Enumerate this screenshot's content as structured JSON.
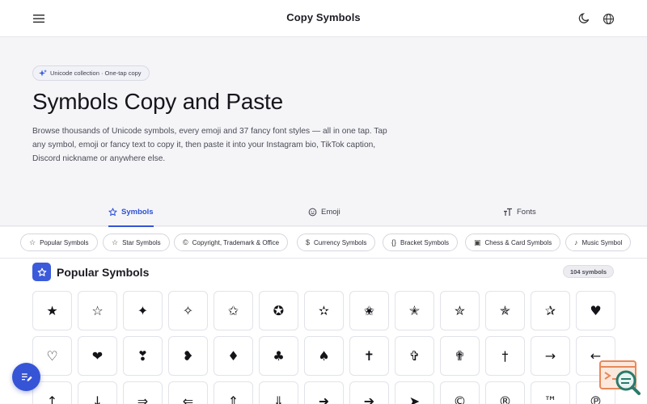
{
  "header": {
    "title": "Copy Symbols",
    "icons": [
      "menu-icon",
      "moon-icon",
      "globe-icon"
    ]
  },
  "hero": {
    "pill_icon": "sparkle-icon",
    "pill_text": "Unicode collection · One-tap copy",
    "title": "Symbols Copy and Paste",
    "description": "Browse thousands of Unicode symbols, every emoji and 37 fancy font styles — all in one tap. Tap any symbol, emoji or fancy text to copy it, then paste it into your Instagram bio, TikTok caption, Discord nickname or anywhere else."
  },
  "tabs": [
    {
      "label": "Symbols",
      "icon": "star-outline-icon",
      "active": true
    },
    {
      "label": "Emoji",
      "icon": "smiley-icon",
      "active": false
    },
    {
      "label": "Fonts",
      "icon": "text-icon",
      "active": false
    }
  ],
  "chips": [
    {
      "label": "Popular Symbols",
      "icon": "☆"
    },
    {
      "label": "Star Symbols",
      "icon": "☆"
    },
    {
      "label": "Copyright, Trademark & Office",
      "icon": "©"
    },
    {
      "label": "Currency Symbols",
      "icon": "$"
    },
    {
      "label": "Bracket Symbols",
      "icon": "{}"
    },
    {
      "label": "Chess & Card Symbols",
      "icon": "▣"
    },
    {
      "label": "Music Symbol",
      "icon": "♪"
    }
  ],
  "section": {
    "title": "Popular Symbols",
    "icon": "star-outline-icon",
    "count": "104 symbols"
  },
  "symbols": [
    [
      "★",
      "☆",
      "✦",
      "✧",
      "✩",
      "✪",
      "✫",
      "✬",
      "✭",
      "✮",
      "✯",
      "✰",
      "♥"
    ],
    [
      "♡",
      "❤",
      "❣",
      "❥",
      "♦",
      "♣",
      "♠",
      "✝",
      "✞",
      "✟",
      "†",
      "→",
      "←"
    ],
    [
      "↑",
      "↓",
      "⇒",
      "⇐",
      "⇑",
      "⇓",
      "➜",
      "➔",
      "➤",
      "©",
      "®",
      "™",
      "℗"
    ]
  ],
  "colors": {
    "accent": "#3554d8",
    "background": "#f5f5f8",
    "text": "#15151b"
  },
  "floating": {
    "fab_icon": "edit-note-icon",
    "corner_logo": "search-document-logo"
  }
}
